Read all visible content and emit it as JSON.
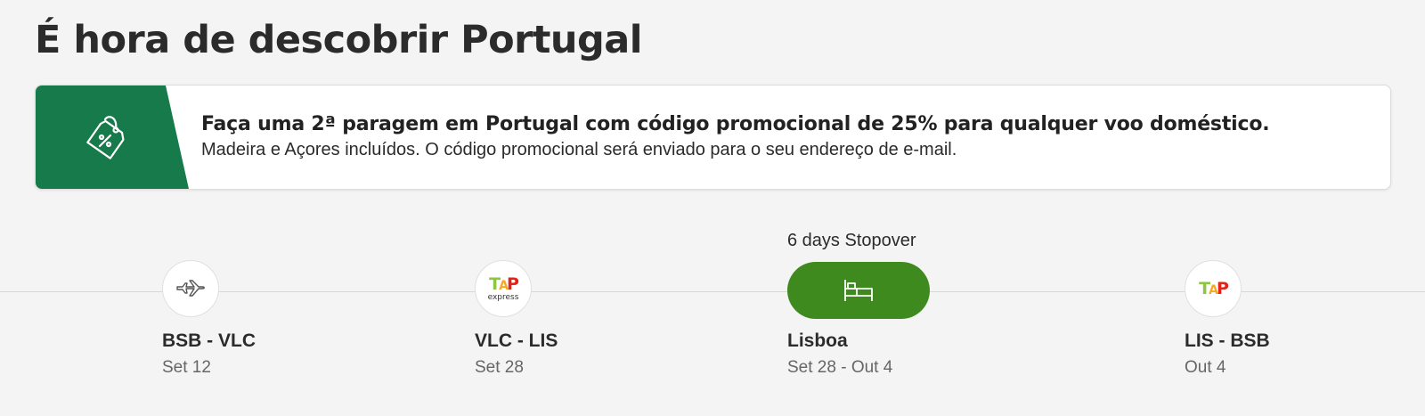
{
  "page": {
    "title": "É hora de descobrir Portugal"
  },
  "promo": {
    "icon": "discount-tag-icon",
    "headline": "Faça uma 2ª paragem em Portugal com código promocional de 25% para qualquer voo doméstico.",
    "subtext": "Madeira e Açores incluídos. O código promocional será enviado para o seu endereço de e-mail.",
    "accent_color": "#167a4a"
  },
  "itinerary": {
    "stops": [
      {
        "icon": "airplane-icon",
        "route": "BSB - VLC",
        "date": "Set 12"
      },
      {
        "icon": "tap-express-logo",
        "logo_letters": [
          "T",
          "A",
          "P"
        ],
        "logo_sub": "express",
        "route": "VLC - LIS",
        "date": "Set 28"
      },
      {
        "icon": "bed-icon",
        "above": "6 days Stopover",
        "route": "Lisboa",
        "date": "Set 28 - Out 4",
        "color": "#3f8a1e"
      },
      {
        "icon": "tap-logo",
        "logo_letters": [
          "T",
          "A",
          "P"
        ],
        "route": "LIS - BSB",
        "date": "Out 4"
      }
    ]
  }
}
